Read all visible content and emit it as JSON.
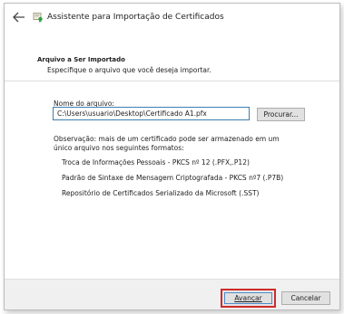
{
  "window": {
    "title": "Assistente para Importação de Certificados"
  },
  "header": {
    "heading": "Arquivo a Ser Importado",
    "description": "Especifique o arquivo que você deseja importar."
  },
  "form": {
    "file_label": "Nome do arquivo:",
    "file_value": "C:\\Users\\usuario\\Desktop\\Certificado A1.pfx",
    "browse_label": "Procurar..."
  },
  "note": {
    "line1": "Observação: mais de um certificado pode ser armazenado em um",
    "line2": "único arquivo nos seguintes formatos:",
    "formats": [
      "Troca de Informações Pessoais - PKCS nº 12 (.PFX,.P12)",
      "Padrão de Sintaxe de Mensagem Criptografada - PKCS nº7 (.P7B)",
      "Repositório de Certificados Serializado da Microsoft (.SST)"
    ]
  },
  "footer": {
    "next_label": "Avançar",
    "cancel_label": "Cancelar"
  },
  "colors": {
    "accent_border": "#3c7fb1",
    "highlight_red": "#d02a2a"
  },
  "icons": {
    "back": "back-arrow-icon",
    "app": "certificate-icon"
  }
}
